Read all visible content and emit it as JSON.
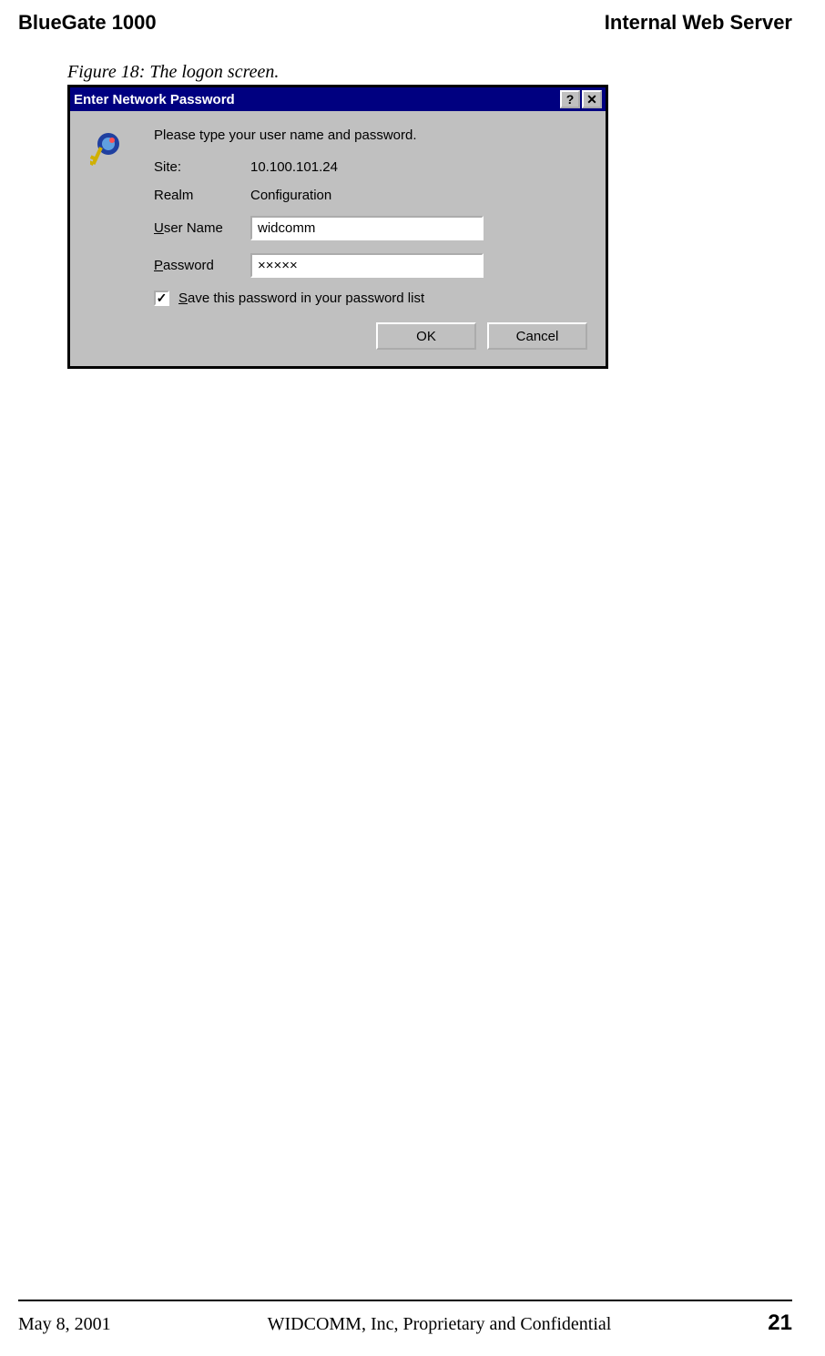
{
  "header": {
    "left": "BlueGate 1000",
    "right": "Internal Web Server"
  },
  "figure_caption": "Figure 18: The logon screen.",
  "dialog": {
    "title": "Enter Network Password",
    "help_btn": "?",
    "close_btn": "✕",
    "instruction": "Please type your user name and password.",
    "site_label": "Site:",
    "site_value": "10.100.101.24",
    "realm_label": "Realm",
    "realm_value": "Configuration",
    "user_label_u": "U",
    "user_label_rest": "ser Name",
    "user_value": "widcomm",
    "pass_label_u": "P",
    "pass_label_rest": "assword",
    "pass_value": "×××××",
    "check_mark": "✓",
    "save_label_u": "S",
    "save_label_rest": "ave this password in your password list",
    "ok_btn": "OK",
    "cancel_btn": "Cancel"
  },
  "footer": {
    "date": "May 8, 2001",
    "center": "WIDCOMM, Inc, Proprietary and Confidential",
    "page": "21"
  }
}
